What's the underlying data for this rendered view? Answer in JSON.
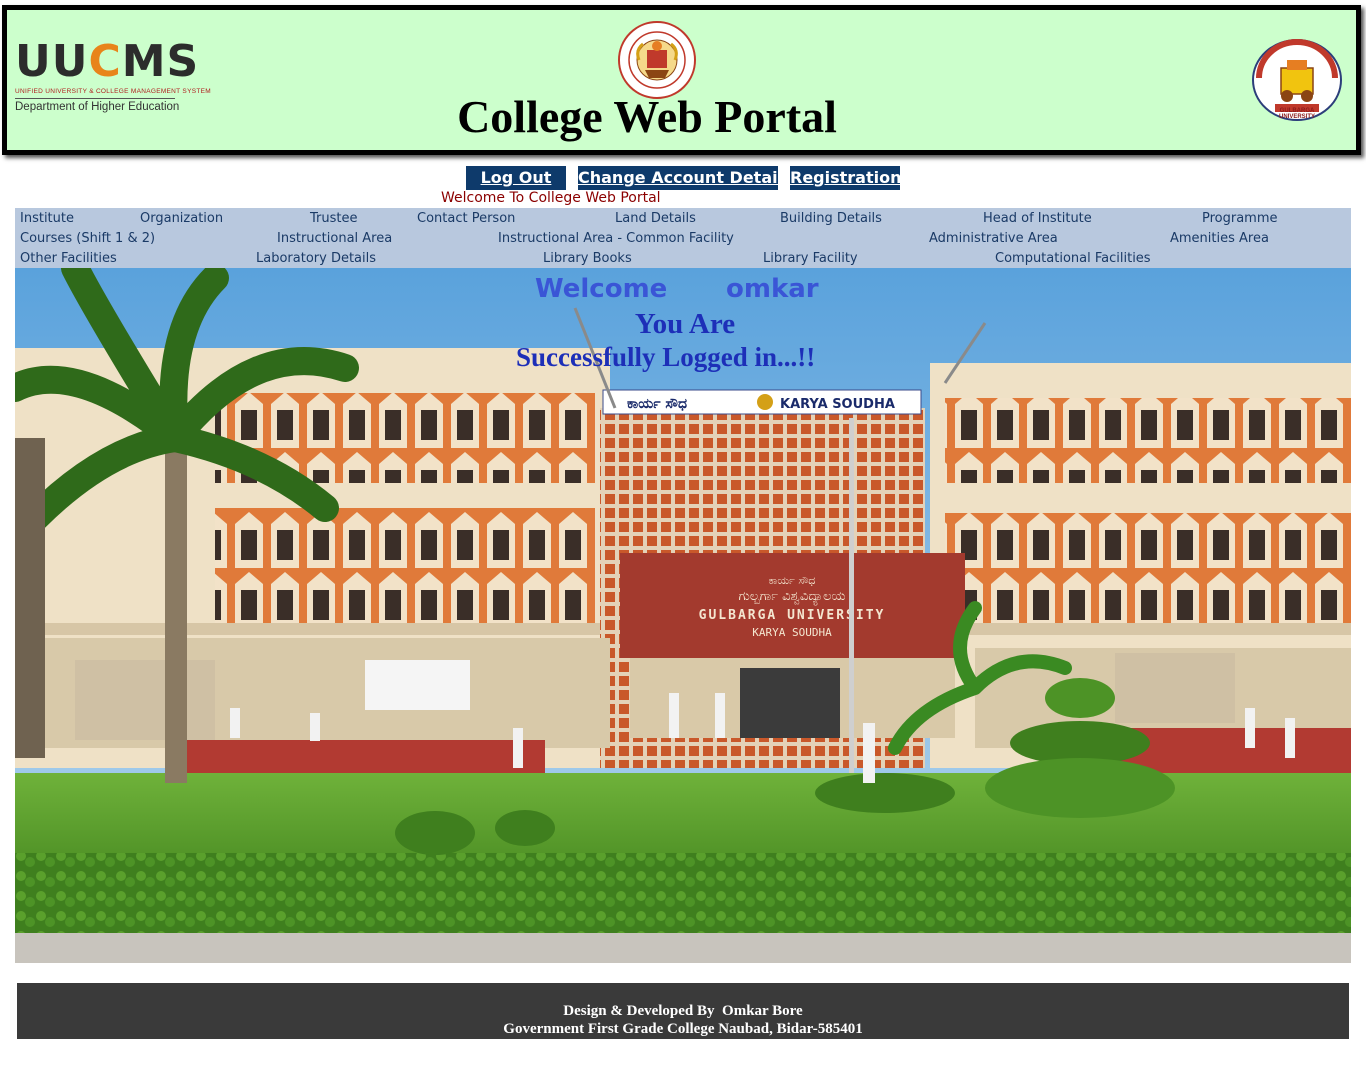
{
  "header": {
    "logo_word_left": "UU",
    "logo_word_accent": "C",
    "logo_word_right": "MS",
    "logo_subtitle": "UNIFIED UNIVERSITY & COLLEGE MANAGEMENT SYSTEM",
    "logo_dept": "Department of Higher Education",
    "title": "College Web Portal",
    "gu_caption": "GULBARGA UNIVERSITY"
  },
  "top_nav": {
    "logout": "Log Out",
    "change_account": "Change Account Details",
    "registration": "Registration",
    "marquee": "Welcome To College Web Portal"
  },
  "menu": {
    "row1": [
      "Institute",
      "Organization",
      "Trustee",
      "Contact Person",
      "Land Details",
      "Building Details",
      "Head of Institute",
      "Programme"
    ],
    "row2": [
      "Courses (Shift 1 & 2)",
      "Instructional Area",
      "Instructional Area - Common Facility",
      "Administrative Area",
      "Amenities Area"
    ],
    "row3": [
      "Other Facilities",
      "Laboratory Details",
      "Library Books",
      "Library Facility",
      "Computational Facilities"
    ]
  },
  "hero": {
    "welcome": "Welcome",
    "username": "omkar",
    "line2": "You Are",
    "line3": "Successfully Logged in...!!",
    "building_sign_kn": "ಕಾರ್ಯ ಸೌಧ",
    "building_sign_en": "KARYA SOUDHA",
    "panel_line1": "ಕಾರ್ಯ ಸೌಧ",
    "panel_line2_kn": "ಗುಲ್ಬರ್ಗಾ ವಿಶ್ವವಿದ್ಯಾಲಯ",
    "panel_line3": "GULBARGA UNIVERSITY",
    "panel_line4": "KARYA SOUDHA"
  },
  "footer": {
    "line1": "Design & Developed By  Omkar Bore",
    "line2": "Government First Grade College Naubad, Bidar-585401"
  },
  "colors": {
    "header_bg": "#ccffcc",
    "button_bg": "#0e3a6b",
    "menu_bg": "#b8c8de",
    "menu_text": "#1a3a66",
    "welcome_blue": "#3a55d6",
    "footer_bg": "#3a3a3a"
  }
}
